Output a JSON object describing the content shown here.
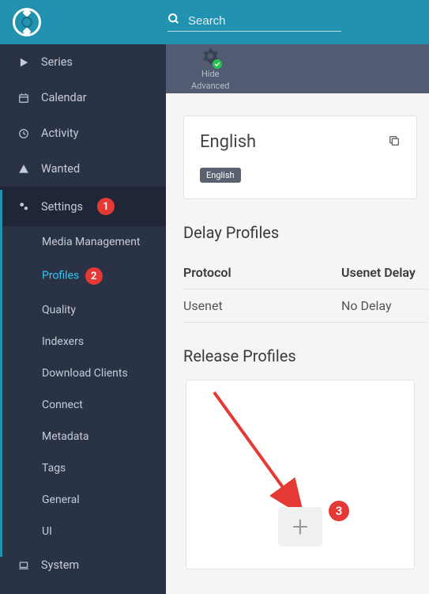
{
  "search": {
    "placeholder": "Search"
  },
  "sidebar": {
    "series": "Series",
    "calendar": "Calendar",
    "activity": "Activity",
    "wanted": "Wanted",
    "settings": "Settings",
    "system": "System",
    "sub": {
      "media_management": "Media Management",
      "profiles": "Profiles",
      "quality": "Quality",
      "indexers": "Indexers",
      "download_clients": "Download Clients",
      "connect": "Connect",
      "metadata": "Metadata",
      "tags": "Tags",
      "general": "General",
      "ui": "UI"
    }
  },
  "toolbar": {
    "hide": "Hide",
    "advanced": "Advanced"
  },
  "profile_card": {
    "title": "English",
    "tag": "English"
  },
  "delay": {
    "heading": "Delay Profiles",
    "col_protocol": "Protocol",
    "col_usenet_delay": "Usenet Delay",
    "row_protocol": "Usenet",
    "row_delay": "No Delay"
  },
  "release": {
    "heading": "Release Profiles"
  },
  "annotations": {
    "step1": "1",
    "step2": "2",
    "step3": "3"
  }
}
